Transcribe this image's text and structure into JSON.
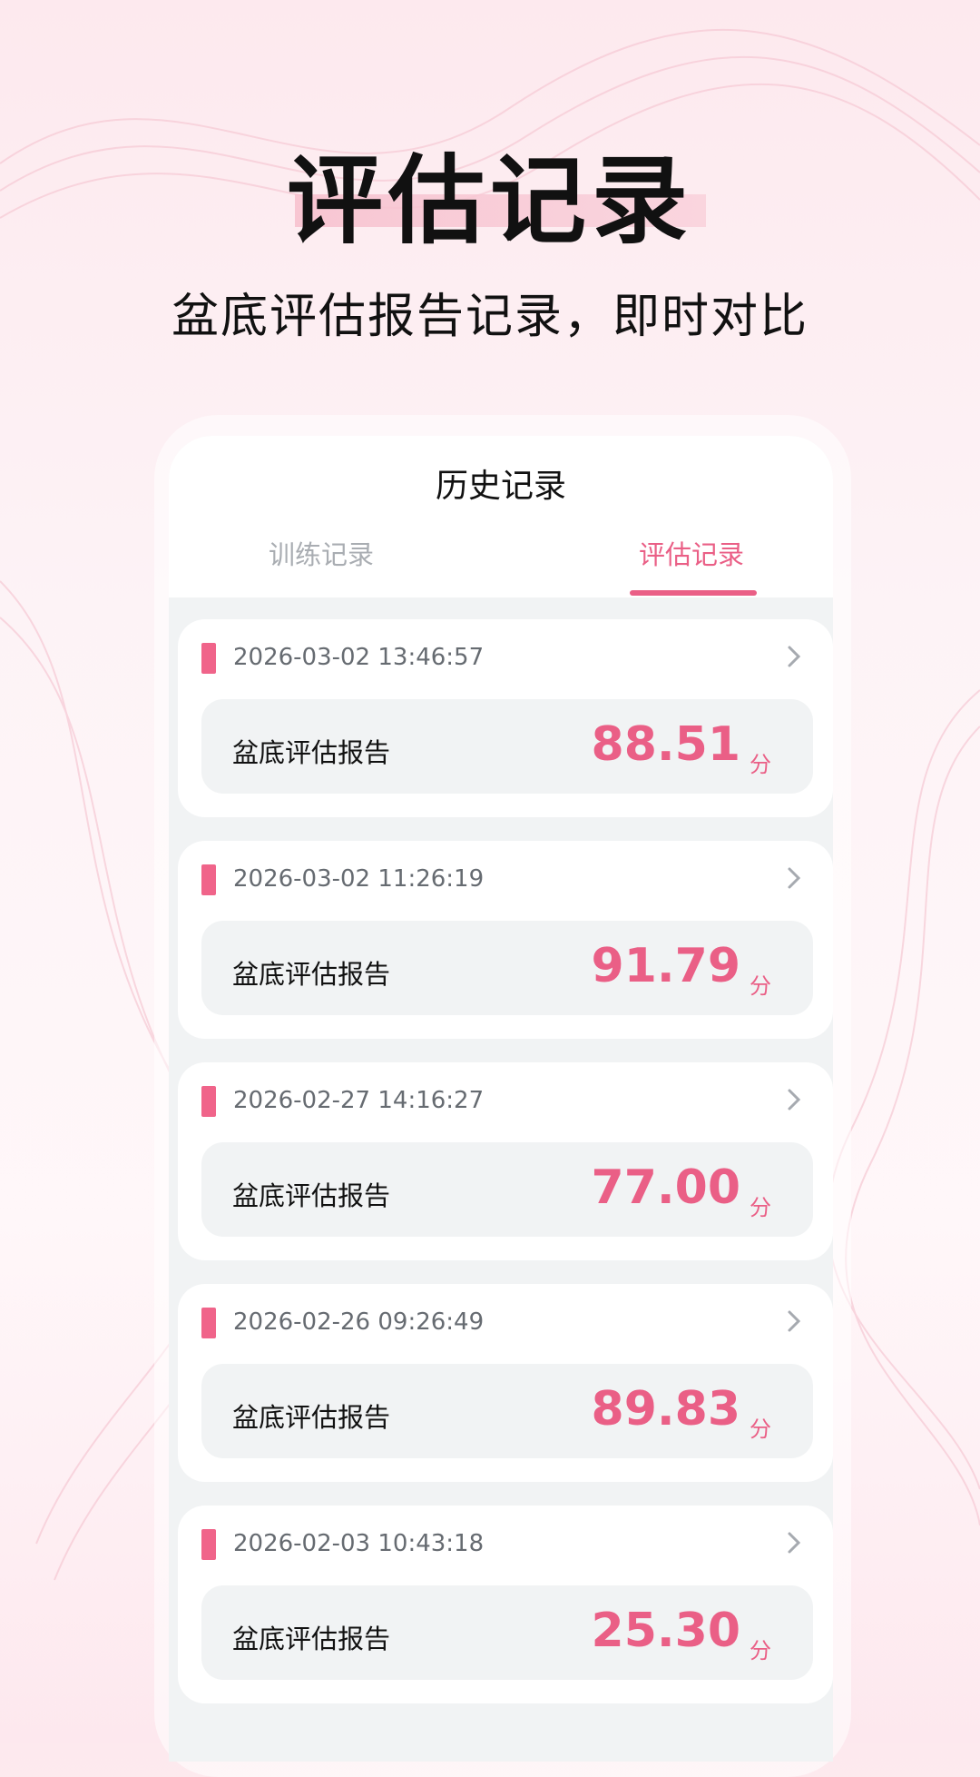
{
  "hero": {
    "title": "评估记录",
    "subtitle": "盆底评估报告记录，即时对比"
  },
  "screen": {
    "title": "历史记录",
    "tabs": [
      {
        "label": "训练记录",
        "active": false
      },
      {
        "label": "评估记录",
        "active": true
      }
    ]
  },
  "records": [
    {
      "datetime": "2026-03-02 13:46:57",
      "name": "盆底评估报告",
      "score": "88.51",
      "unit": "分"
    },
    {
      "datetime": "2026-03-02 11:26:19",
      "name": "盆底评估报告",
      "score": "91.79",
      "unit": "分"
    },
    {
      "datetime": "2026-02-27 14:16:27",
      "name": "盆底评估报告",
      "score": "77.00",
      "unit": "分"
    },
    {
      "datetime": "2026-02-26 09:26:49",
      "name": "盆底评估报告",
      "score": "89.83",
      "unit": "分"
    },
    {
      "datetime": "2026-02-03 10:43:18",
      "name": "盆底评估报告",
      "score": "25.30",
      "unit": "分"
    }
  ],
  "colors": {
    "accent": "#ea5f86",
    "marker": "#f0648a",
    "inactive_tab": "#a9adb2",
    "card_inner": "#f1f3f4"
  },
  "icons": {
    "chevron": "chevron-right-icon",
    "marker": "record-marker-icon"
  }
}
